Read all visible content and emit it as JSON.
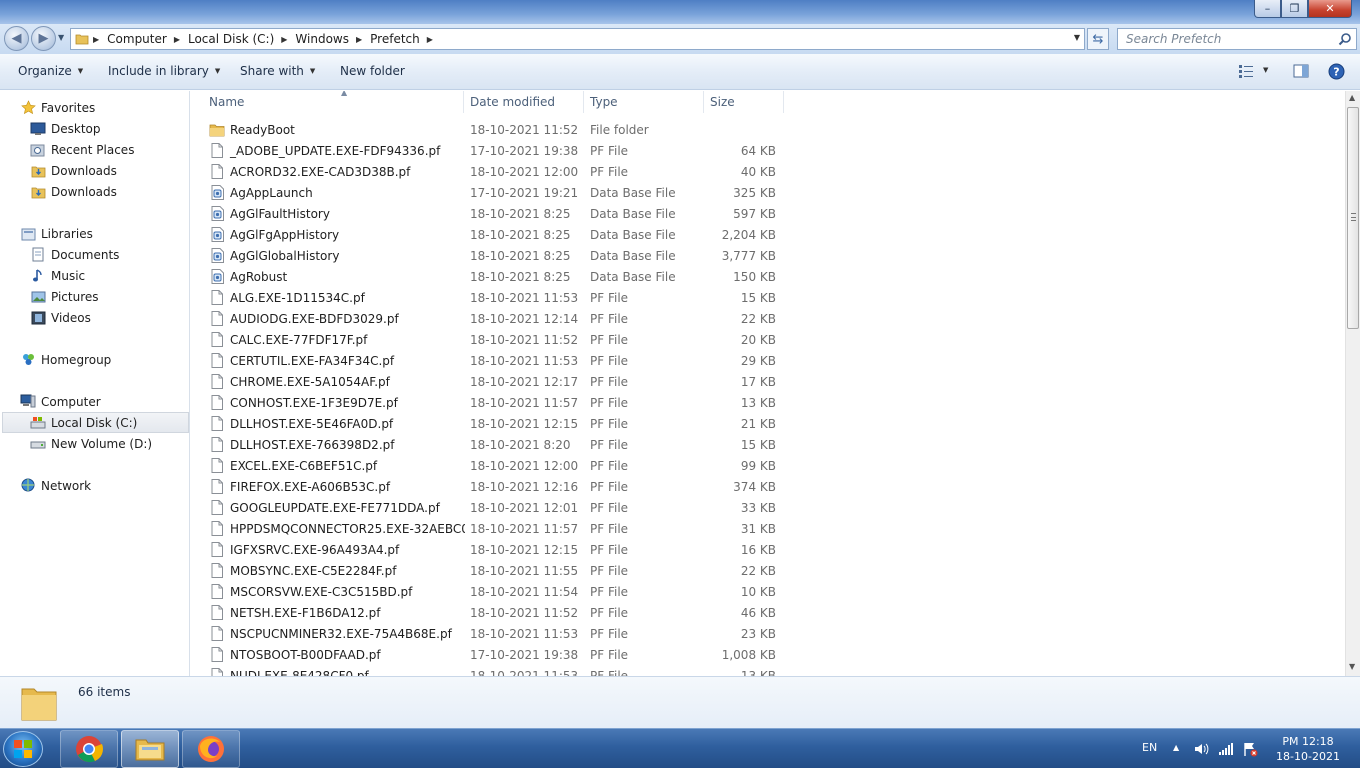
{
  "window": {
    "minimize_label": "–",
    "maximize_label": "❐",
    "close_label": "✕"
  },
  "address": {
    "crumbs": [
      "Computer",
      "Local Disk (C:)",
      "Windows",
      "Prefetch"
    ],
    "search_placeholder": "Search Prefetch"
  },
  "toolbar": {
    "organize": "Organize",
    "include_in_library": "Include in library",
    "share_with": "Share with",
    "new_folder": "New folder"
  },
  "nav": {
    "favorites": "Favorites",
    "desktop": "Desktop",
    "recent_places": "Recent Places",
    "downloads_1": "Downloads",
    "downloads_2": "Downloads",
    "libraries": "Libraries",
    "documents": "Documents",
    "music": "Music",
    "pictures": "Pictures",
    "videos": "Videos",
    "homegroup": "Homegroup",
    "computer": "Computer",
    "local_disk": "Local Disk (C:)",
    "new_volume": "New Volume (D:)",
    "network": "Network"
  },
  "columns": {
    "name": "Name",
    "date_modified": "Date modified",
    "type": "Type",
    "size": "Size"
  },
  "files": [
    {
      "name": "ReadyBoot",
      "date": "18-10-2021 11:52",
      "type": "File folder",
      "size": "",
      "icon": "folder"
    },
    {
      "name": "_ADOBE_UPDATE.EXE-FDF94336.pf",
      "date": "17-10-2021 19:38",
      "type": "PF File",
      "size": "64 KB",
      "icon": "file"
    },
    {
      "name": "ACRORD32.EXE-CAD3D38B.pf",
      "date": "18-10-2021 12:00",
      "type": "PF File",
      "size": "40 KB",
      "icon": "file"
    },
    {
      "name": "AgAppLaunch",
      "date": "17-10-2021 19:21",
      "type": "Data Base File",
      "size": "325 KB",
      "icon": "db"
    },
    {
      "name": "AgGlFaultHistory",
      "date": "18-10-2021 8:25",
      "type": "Data Base File",
      "size": "597 KB",
      "icon": "db"
    },
    {
      "name": "AgGlFgAppHistory",
      "date": "18-10-2021 8:25",
      "type": "Data Base File",
      "size": "2,204 KB",
      "icon": "db"
    },
    {
      "name": "AgGlGlobalHistory",
      "date": "18-10-2021 8:25",
      "type": "Data Base File",
      "size": "3,777 KB",
      "icon": "db"
    },
    {
      "name": "AgRobust",
      "date": "18-10-2021 8:25",
      "type": "Data Base File",
      "size": "150 KB",
      "icon": "db"
    },
    {
      "name": "ALG.EXE-1D11534C.pf",
      "date": "18-10-2021 11:53",
      "type": "PF File",
      "size": "15 KB",
      "icon": "file"
    },
    {
      "name": "AUDIODG.EXE-BDFD3029.pf",
      "date": "18-10-2021 12:14",
      "type": "PF File",
      "size": "22 KB",
      "icon": "file"
    },
    {
      "name": "CALC.EXE-77FDF17F.pf",
      "date": "18-10-2021 11:52",
      "type": "PF File",
      "size": "20 KB",
      "icon": "file"
    },
    {
      "name": "CERTUTIL.EXE-FA34F34C.pf",
      "date": "18-10-2021 11:53",
      "type": "PF File",
      "size": "29 KB",
      "icon": "file"
    },
    {
      "name": "CHROME.EXE-5A1054AF.pf",
      "date": "18-10-2021 12:17",
      "type": "PF File",
      "size": "17 KB",
      "icon": "file"
    },
    {
      "name": "CONHOST.EXE-1F3E9D7E.pf",
      "date": "18-10-2021 11:57",
      "type": "PF File",
      "size": "13 KB",
      "icon": "file"
    },
    {
      "name": "DLLHOST.EXE-5E46FA0D.pf",
      "date": "18-10-2021 12:15",
      "type": "PF File",
      "size": "21 KB",
      "icon": "file"
    },
    {
      "name": "DLLHOST.EXE-766398D2.pf",
      "date": "18-10-2021 8:20",
      "type": "PF File",
      "size": "15 KB",
      "icon": "file"
    },
    {
      "name": "EXCEL.EXE-C6BEF51C.pf",
      "date": "18-10-2021 12:00",
      "type": "PF File",
      "size": "99 KB",
      "icon": "file"
    },
    {
      "name": "FIREFOX.EXE-A606B53C.pf",
      "date": "18-10-2021 12:16",
      "type": "PF File",
      "size": "374 KB",
      "icon": "file"
    },
    {
      "name": "GOOGLEUPDATE.EXE-FE771DDA.pf",
      "date": "18-10-2021 12:01",
      "type": "PF File",
      "size": "33 KB",
      "icon": "file"
    },
    {
      "name": "HPPDSMQCONNECTOR25.EXE-32AEBC0...",
      "date": "18-10-2021 11:57",
      "type": "PF File",
      "size": "31 KB",
      "icon": "file"
    },
    {
      "name": "IGFXSRVC.EXE-96A493A4.pf",
      "date": "18-10-2021 12:15",
      "type": "PF File",
      "size": "16 KB",
      "icon": "file"
    },
    {
      "name": "MOBSYNC.EXE-C5E2284F.pf",
      "date": "18-10-2021 11:55",
      "type": "PF File",
      "size": "22 KB",
      "icon": "file"
    },
    {
      "name": "MSCORSVW.EXE-C3C515BD.pf",
      "date": "18-10-2021 11:54",
      "type": "PF File",
      "size": "10 KB",
      "icon": "file"
    },
    {
      "name": "NETSH.EXE-F1B6DA12.pf",
      "date": "18-10-2021 11:52",
      "type": "PF File",
      "size": "46 KB",
      "icon": "file"
    },
    {
      "name": "NSCPUCNMINER32.EXE-75A4B68E.pf",
      "date": "18-10-2021 11:53",
      "type": "PF File",
      "size": "23 KB",
      "icon": "file"
    },
    {
      "name": "NTOSBOOT-B00DFAAD.pf",
      "date": "17-10-2021 19:38",
      "type": "PF File",
      "size": "1,008 KB",
      "icon": "file"
    },
    {
      "name": "NUDI.EXE-8E428CF0.pf",
      "date": "18-10-2021 11:53",
      "type": "PF File",
      "size": "13 KB",
      "icon": "file"
    }
  ],
  "details": {
    "items_count": "66 items"
  },
  "taskbar": {
    "language": "EN",
    "time": "PM 12:18",
    "date": "18-10-2021"
  }
}
